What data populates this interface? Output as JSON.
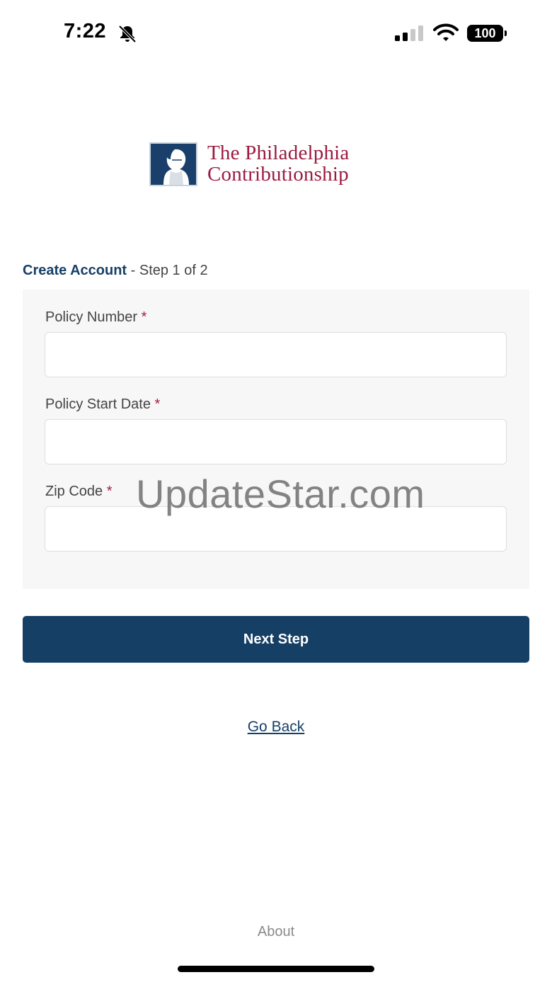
{
  "status_bar": {
    "time": "7:22",
    "battery": "100",
    "icons": [
      "bell-slash-icon",
      "signal-icon",
      "wifi-icon",
      "battery-icon"
    ]
  },
  "logo": {
    "line1": "The Philadelphia",
    "line2": "Contributionship",
    "colors": {
      "mark": "#1a3f6b",
      "text": "#9b1b41"
    }
  },
  "heading": {
    "title": "Create Account",
    "step": "- Step 1 of 2"
  },
  "form": {
    "required_marker": "*",
    "fields": [
      {
        "label": "Policy Number",
        "value": "",
        "placeholder": ""
      },
      {
        "label": "Policy Start Date",
        "value": "",
        "placeholder": ""
      },
      {
        "label": "Zip Code",
        "value": "",
        "placeholder": ""
      }
    ]
  },
  "watermark": "UpdateStar.com",
  "actions": {
    "next_label": "Next Step",
    "back_label": "Go Back"
  },
  "footer": {
    "about_label": "About"
  },
  "colors": {
    "primary": "#163f66",
    "required": "#a3213d",
    "panel": "#f7f7f7"
  }
}
